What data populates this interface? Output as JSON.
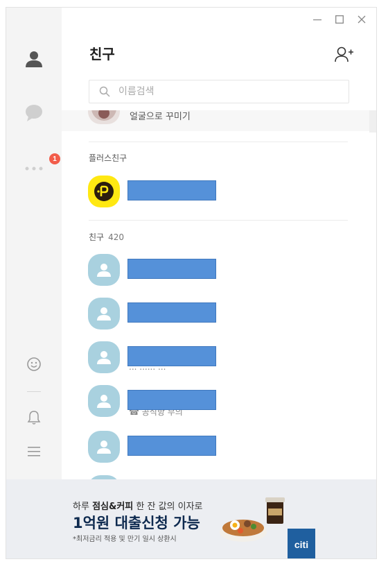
{
  "window": {
    "controls": {
      "minimize": "minimize-icon",
      "maximize": "maximize-icon",
      "close": "close-icon"
    }
  },
  "sidebar": {
    "items": [
      {
        "name": "friends",
        "icon": "person-icon"
      },
      {
        "name": "chats",
        "icon": "chat-bubble-icon"
      },
      {
        "name": "more",
        "icon": "more-dots-icon",
        "badge": "1"
      }
    ],
    "bottom": [
      {
        "name": "emoticon",
        "icon": "smiley-icon"
      },
      {
        "name": "notifications",
        "icon": "bell-icon"
      },
      {
        "name": "settings",
        "icon": "hamburger-menu-icon"
      }
    ]
  },
  "header": {
    "title": "친구"
  },
  "search": {
    "placeholder": "이름검색"
  },
  "list": {
    "previous_row_text": "얼굴으로 꾸미기",
    "plus_section": {
      "label": "플러스친구"
    },
    "friends_section": {
      "label": "친구",
      "count": "420"
    },
    "friends": [
      {
        "redacted": true
      },
      {
        "redacted": true
      },
      {
        "redacted": true,
        "status": "... ...... ..."
      },
      {
        "redacted": true,
        "status": "☎ 공식항 무의"
      },
      {
        "redacted": true
      }
    ]
  },
  "ad": {
    "line1_prefix": "하루 ",
    "line1_bold": "점심&커피",
    "line1_suffix": " 한 잔 값의 이자로",
    "line2": "1억원 대출신청 가능",
    "line3": "*최저금리 적용 및 만기 일시 상환시",
    "brand": "citi"
  },
  "colors": {
    "badge": "#f25c4a",
    "avatar_default": "#a9d1df",
    "plus_yellow": "#ffe812",
    "redaction": "#5591d9"
  }
}
